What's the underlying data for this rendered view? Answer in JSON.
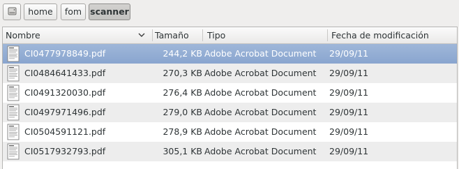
{
  "pathbar": {
    "crumbs": [
      {
        "label": "home"
      },
      {
        "label": "fom"
      },
      {
        "label": "scanner"
      }
    ]
  },
  "columns": {
    "name": "Nombre",
    "size": "Tamaño",
    "type": "Tipo",
    "modified": "Fecha de modificación"
  },
  "files": [
    {
      "name": "CI0477978849.pdf",
      "size": "244,2 KB",
      "type": "Adobe Acrobat Document",
      "modified": "29/09/11",
      "selected": true
    },
    {
      "name": "CI0484641433.pdf",
      "size": "270,3 KB",
      "type": "Adobe Acrobat Document",
      "modified": "29/09/11"
    },
    {
      "name": "CI0491320030.pdf",
      "size": "276,4 KB",
      "type": "Adobe Acrobat Document",
      "modified": "29/09/11"
    },
    {
      "name": "CI0497971496.pdf",
      "size": "279,0 KB",
      "type": "Adobe Acrobat Document",
      "modified": "29/09/11"
    },
    {
      "name": "CI0504591121.pdf",
      "size": "278,9 KB",
      "type": "Adobe Acrobat Document",
      "modified": "29/09/11"
    },
    {
      "name": "CI0517932793.pdf",
      "size": "305,1 KB",
      "type": "Adobe Acrobat Document",
      "modified": "29/09/11"
    }
  ],
  "icons": {
    "root": "drive-icon",
    "sort": "sort-descending-icon",
    "file": "pdf-document-icon"
  },
  "colors": {
    "selection": "#89a5cf",
    "alternate_row": "#ededed"
  }
}
